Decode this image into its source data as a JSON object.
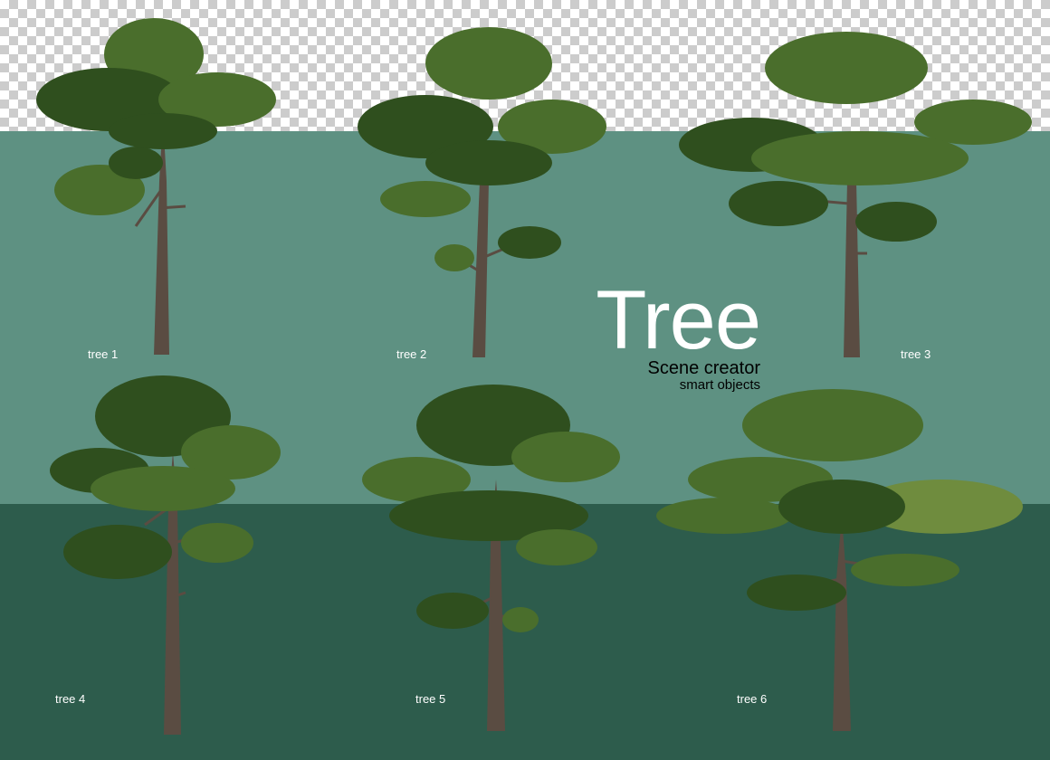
{
  "colors": {
    "checker_light": "#ffffff",
    "checker_dark": "#cccccc",
    "wall": "#5e9182",
    "floor": "#2d5c4c",
    "trunk": "#5a4c42",
    "foliage_dark": "#2f4f1e",
    "foliage_mid": "#4a6e2c",
    "foliage_light": "#6f8c3e"
  },
  "title": {
    "main": "Tree",
    "sub": "Scene creator",
    "sub2": "smart objects"
  },
  "trees": [
    {
      "label": "tree 1"
    },
    {
      "label": "tree 2"
    },
    {
      "label": "tree 3"
    },
    {
      "label": "tree 4"
    },
    {
      "label": "tree 5"
    },
    {
      "label": "tree 6"
    }
  ]
}
